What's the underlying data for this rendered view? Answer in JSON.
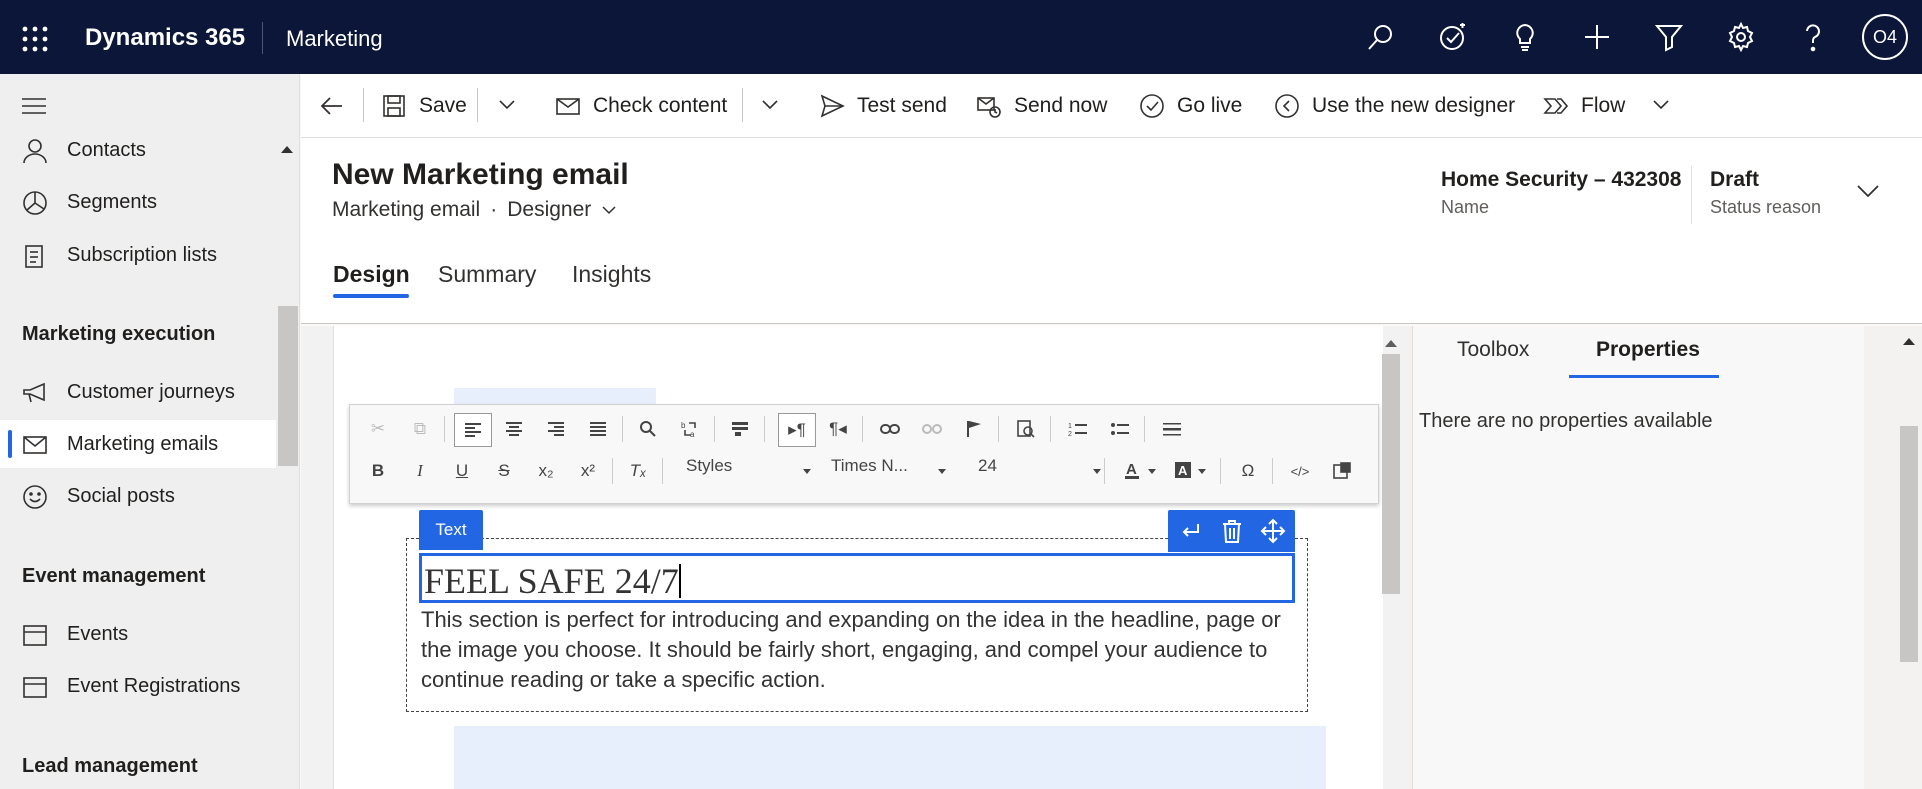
{
  "topbar": {
    "brand": "Dynamics 365",
    "app_name": "Marketing",
    "avatar_initials": "O4",
    "icons": [
      "search-icon",
      "task-check-icon",
      "lightbulb-icon",
      "plus-icon",
      "filter-icon",
      "gear-icon",
      "help-icon"
    ]
  },
  "nav": {
    "items_top": [
      {
        "label": "Contacts",
        "icon": "person-icon"
      },
      {
        "label": "Segments",
        "icon": "pie-icon"
      },
      {
        "label": "Subscription lists",
        "icon": "list-icon"
      }
    ],
    "section_marketing_execution": "Marketing execution",
    "items_marketing_execution": [
      {
        "label": "Customer journeys",
        "icon": "megaphone-icon"
      },
      {
        "label": "Marketing emails",
        "icon": "mail-icon",
        "selected": true
      },
      {
        "label": "Social posts",
        "icon": "smiley-icon"
      }
    ],
    "section_event_management": "Event management",
    "items_event_management": [
      {
        "label": "Events",
        "icon": "calendar-icon"
      },
      {
        "label": "Event Registrations",
        "icon": "calendar-icon"
      }
    ],
    "section_lead_management": "Lead management"
  },
  "commandbar": {
    "save": "Save",
    "check_content": "Check content",
    "test_send": "Test send",
    "send_now": "Send now",
    "go_live": "Go live",
    "use_new_designer": "Use the new designer",
    "flow": "Flow"
  },
  "header": {
    "title": "New Marketing email",
    "entity": "Marketing email",
    "dot": "·",
    "form": "Designer",
    "name_value": "Home Security – 432308",
    "name_label": "Name",
    "status_value": "Draft",
    "status_label": "Status reason",
    "tabs": [
      "Design",
      "Summary",
      "Insights"
    ]
  },
  "editor": {
    "styles_label": "Styles",
    "font_label": "Times N...",
    "size_label": "24",
    "text_tag": "Text",
    "headline": "FEEL SAFE 24/7",
    "body": "This section is perfect for introducing and expanding on the idea in the headline, page or the image you choose. It should be fairly short, engaging, and compel your audience to continue reading or take a specific action."
  },
  "properties": {
    "tab_toolbox": "Toolbox",
    "tab_properties": "Properties",
    "empty_message": "There are no properties available"
  },
  "colors": {
    "topbar_bg": "#0b1638",
    "accent": "#2266e3",
    "nav_bg": "#efefef"
  }
}
